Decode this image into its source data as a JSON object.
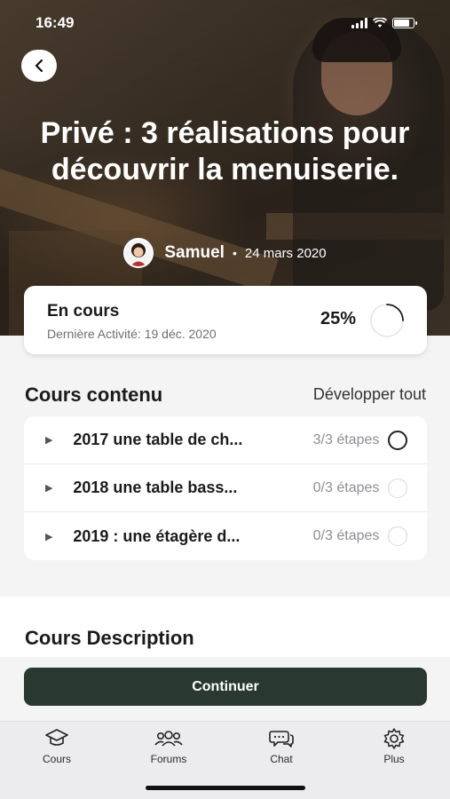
{
  "status_bar": {
    "time": "16:49"
  },
  "hero": {
    "title": "Privé : 3 réalisations pour découvrir la menuiserie.",
    "author_name": "Samuel",
    "separator": "•",
    "date": "24 mars 2020"
  },
  "progress": {
    "status": "En cours",
    "last_activity": "Dernière Activité: 19 déc. 2020",
    "percent_label": "25%",
    "percent_value": 0.25
  },
  "content": {
    "title": "Cours contenu",
    "expand_all": "Développer tout",
    "lessons": [
      {
        "title": "2017 une table de ch...",
        "steps": "3/3 étapes",
        "completed": true
      },
      {
        "title": "2018 une table bass...",
        "steps": "0/3 étapes",
        "completed": false
      },
      {
        "title": "2019 : une étagère d...",
        "steps": "0/3 étapes",
        "completed": false
      }
    ]
  },
  "description": {
    "title": "Cours Description"
  },
  "cta": {
    "label": "Continuer"
  },
  "tabs": [
    {
      "label": "Cours",
      "icon": "graduation-cap-icon"
    },
    {
      "label": "Forums",
      "icon": "users-icon"
    },
    {
      "label": "Chat",
      "icon": "chat-bubbles-icon"
    },
    {
      "label": "Plus",
      "icon": "gear-icon"
    }
  ],
  "colors": {
    "primary": "#293831",
    "background": "#f4f4f5",
    "muted_text": "#8e8e93"
  }
}
